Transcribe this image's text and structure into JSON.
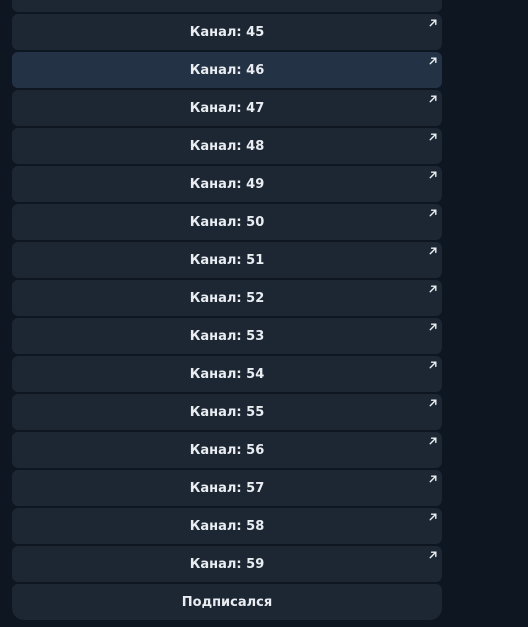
{
  "keyboard": {
    "buttons": [
      {
        "label": "",
        "link": true
      },
      {
        "label": "Канал: 45",
        "link": true
      },
      {
        "label": "Канал: 46",
        "link": true
      },
      {
        "label": "Канал: 47",
        "link": true
      },
      {
        "label": "Канал: 48",
        "link": true
      },
      {
        "label": "Канал: 49",
        "link": true
      },
      {
        "label": "Канал: 50",
        "link": true
      },
      {
        "label": "Канал: 51",
        "link": true
      },
      {
        "label": "Канал: 52",
        "link": true
      },
      {
        "label": "Канал: 53",
        "link": true
      },
      {
        "label": "Канал: 54",
        "link": true
      },
      {
        "label": "Канал: 55",
        "link": true
      },
      {
        "label": "Канал: 56",
        "link": true
      },
      {
        "label": "Канал: 57",
        "link": true
      },
      {
        "label": "Канал: 58",
        "link": true
      },
      {
        "label": "Канал: 59",
        "link": true
      },
      {
        "label": "Подписался",
        "link": false
      }
    ],
    "hovered_index": 2,
    "link_icon": "arrow-up-right-icon"
  },
  "colors": {
    "background": "#0e1621",
    "button": "#1c2733",
    "button_hover": "#233244",
    "text": "#e9edf1"
  }
}
